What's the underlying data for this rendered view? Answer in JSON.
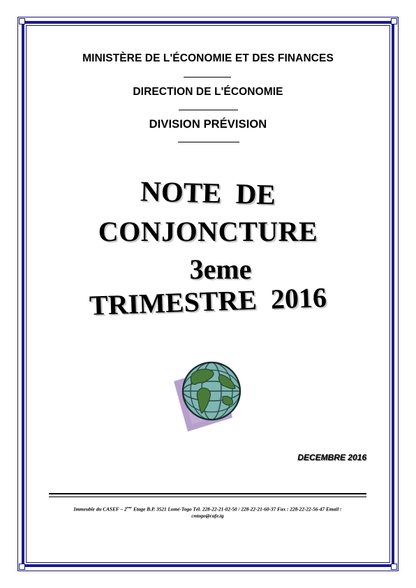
{
  "header": {
    "ministry": "MINISTÈRE DE L'ÉCONOMIE ET DES FINANCES",
    "direction": "DIRECTION DE L'ÉCONOMIE",
    "division": "DIVISION PRÉVISION"
  },
  "title": {
    "line1": "NOTE  DE",
    "line2": "CONJONCTURE",
    "line3": "3eme",
    "line4": "TRIMESTRE  2016"
  },
  "date": "DECEMBRE 2016",
  "footer": {
    "part1": "Immeuble du CASEF – 2",
    "sup": "ème",
    "part2": " Etage B.P. 3521 Lomé-Togo Tél. 228-22-21-02-50 / 228-22-21-60-37  Fax : 228-22-22-56-47 Email :",
    "email": "cntogo@cafe.tg"
  },
  "colors": {
    "border": "#1c1c86",
    "globe_ocean": "#7fb6b2",
    "globe_land": "#4a7a3a",
    "shadow_square": "#a98fc2"
  },
  "icons": {
    "emblem": "globe-icon"
  }
}
